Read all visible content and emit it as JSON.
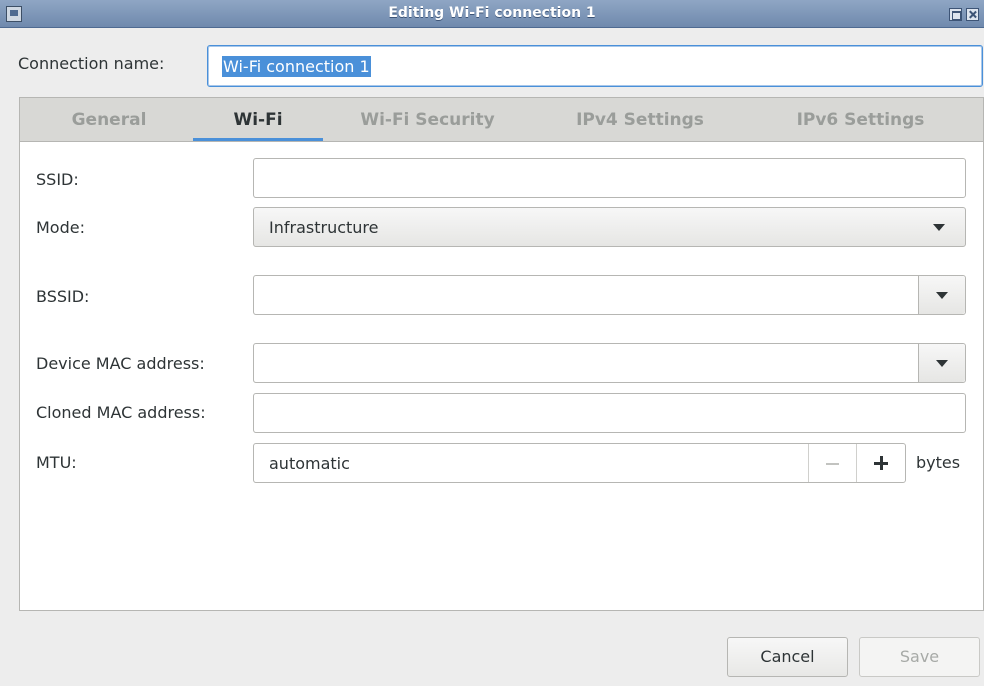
{
  "window": {
    "title": "Editing Wi-Fi connection 1",
    "icon": "network-window-icon"
  },
  "connection": {
    "label": "Connection name:",
    "value": "Wi-Fi connection 1"
  },
  "tabs": [
    {
      "label": "General",
      "active": false
    },
    {
      "label": "Wi-Fi",
      "active": true
    },
    {
      "label": "Wi-Fi Security",
      "active": false
    },
    {
      "label": "IPv4 Settings",
      "active": false
    },
    {
      "label": "IPv6 Settings",
      "active": false
    }
  ],
  "wifi": {
    "ssid_label": "SSID:",
    "ssid_value": "",
    "mode_label": "Mode:",
    "mode_value": "Infrastructure",
    "bssid_label": "BSSID:",
    "bssid_value": "",
    "device_mac_label": "Device MAC address:",
    "device_mac_value": "",
    "cloned_mac_label": "Cloned MAC address:",
    "cloned_mac_value": "",
    "mtu_label": "MTU:",
    "mtu_value": "automatic",
    "mtu_unit": "bytes"
  },
  "buttons": {
    "cancel": "Cancel",
    "save": "Save"
  },
  "colors": {
    "accent": "#4a90d9",
    "titlebar": "#7b94b7"
  }
}
